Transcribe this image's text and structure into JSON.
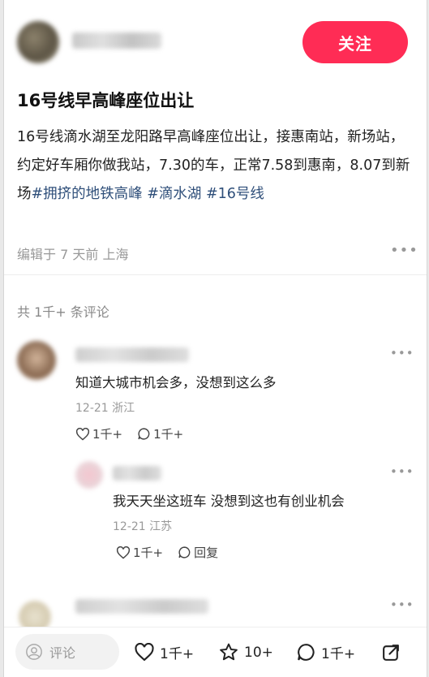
{
  "header": {
    "follow_label": "关注"
  },
  "post": {
    "title": "16号线早高峰座位出让",
    "body_plain": "16号线滴水湖至龙阳路早高峰座位出让，接惠南站，新场站，约定好车厢你做我站，7.30的车，正常7.58到惠南，8.07到新场",
    "tags": [
      "#拥挤的地铁高峰",
      "#滴水湖",
      "#16号线"
    ],
    "meta": "编辑于 7 天前 上海"
  },
  "comments": {
    "count_label": "共 1千+ 条评论",
    "items": [
      {
        "text": "知道大城市机会多，没想到这么多",
        "meta": "12-21 浙江",
        "likes": "1千+",
        "replies": "1千+"
      },
      {
        "text": "我天天坐这班车 没想到这也有创业机会",
        "meta": "12-21 江苏",
        "likes": "1千+",
        "reply_label": "回复"
      }
    ]
  },
  "bottom_bar": {
    "input_placeholder": "评论",
    "likes": "1千+",
    "stars": "10+",
    "comments": "1千+"
  },
  "colors": {
    "accent": "#ff2c55",
    "tag": "#2f4f7a"
  }
}
